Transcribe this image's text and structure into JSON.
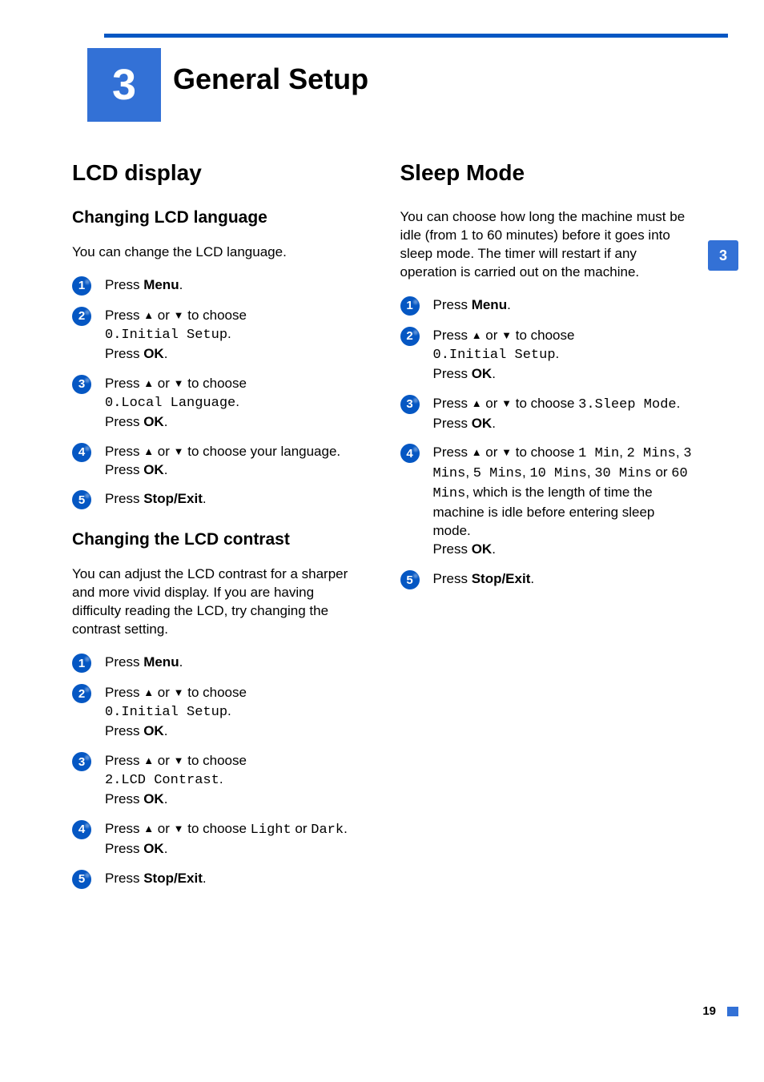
{
  "chapter": {
    "number": "3",
    "title": "General Setup"
  },
  "sideTab": "3",
  "pageNumber": "19",
  "left": {
    "sectionTitle": "LCD display",
    "sub1": {
      "title": "Changing LCD language",
      "intro": "You can change the LCD language.",
      "steps": {
        "s1": {
          "press": "Press ",
          "menu": "Menu",
          "dot": "."
        },
        "s2": {
          "t1": "Press ",
          "up": "▲",
          "or": " or ",
          "down": "▼",
          "t2": " to choose ",
          "code": "0.Initial Setup",
          "dot1": ".",
          "line2a": "Press ",
          "ok": "OK",
          "dot2": "."
        },
        "s3": {
          "t1": "Press ",
          "up": "▲",
          "or": " or ",
          "down": "▼",
          "t2": " to choose ",
          "code": "0.Local Language",
          "dot1": ".",
          "line2a": "Press ",
          "ok": "OK",
          "dot2": "."
        },
        "s4": {
          "t1": "Press ",
          "up": "▲",
          "or": " or ",
          "down": "▼",
          "t2": " to choose your language.",
          "line2a": "Press ",
          "ok": "OK",
          "dot2": "."
        },
        "s5": {
          "press": "Press ",
          "stop": "Stop/Exit",
          "dot": "."
        }
      }
    },
    "sub2": {
      "title": "Changing the LCD contrast",
      "intro": "You can adjust the LCD contrast for a sharper and more vivid display. If you are having difficulty reading the LCD, try changing the contrast setting.",
      "steps": {
        "s1": {
          "press": "Press ",
          "menu": "Menu",
          "dot": "."
        },
        "s2": {
          "t1": "Press ",
          "up": "▲",
          "or": " or ",
          "down": "▼",
          "t2": " to choose ",
          "code": "0.Initial Setup",
          "dot1": ".",
          "line2a": "Press ",
          "ok": "OK",
          "dot2": "."
        },
        "s3": {
          "t1": "Press ",
          "up": "▲",
          "or": " or ",
          "down": "▼",
          "t2": " to choose ",
          "code": "2.LCD Contrast",
          "dot1": ".",
          "line2a": "Press ",
          "ok": "OK",
          "dot2": "."
        },
        "s4": {
          "t1": "Press ",
          "up": "▲",
          "or": " or ",
          "down": "▼",
          "t2": " to choose ",
          "codeL": "Light",
          "orWord": " or ",
          "codeD": "Dark",
          "dot1": ".",
          "line2a": "Press ",
          "ok": "OK",
          "dot2": "."
        },
        "s5": {
          "press": "Press ",
          "stop": "Stop/Exit",
          "dot": "."
        }
      }
    }
  },
  "right": {
    "sectionTitle": "Sleep Mode",
    "intro": "You can choose how long the machine must be idle (from 1 to 60 minutes) before it goes into sleep mode. The timer will restart if any operation is carried out on the machine.",
    "steps": {
      "s1": {
        "press": "Press ",
        "menu": "Menu",
        "dot": "."
      },
      "s2": {
        "t1": "Press ",
        "up": "▲",
        "or": " or ",
        "down": "▼",
        "t2": " to choose ",
        "code": "0.Initial Setup",
        "dot1": ".",
        "line2a": "Press ",
        "ok": "OK",
        "dot2": "."
      },
      "s3": {
        "t1": "Press ",
        "up": "▲",
        "or": " or ",
        "down": "▼",
        "t2": " to choose ",
        "code": "3.Sleep Mode",
        "dot1": ".",
        "line2a": "Press ",
        "ok": "OK",
        "dot2": "."
      },
      "s4": {
        "t1": "Press ",
        "up": "▲",
        "or": " or ",
        "down": "▼",
        "t2": " to choose ",
        "c1": "1 Min",
        "comma1": ", ",
        "c2": "2 Mins",
        "comma2": ", ",
        "c3": "3 Mins",
        "comma3": ", ",
        "c4": "5 Mins",
        "comma4": ", ",
        "c5": "10 Mins",
        "comma5": ", ",
        "c6": "30 Mins",
        "orWord": " or ",
        "c7": "60 Mins",
        "commaLast": ", ",
        "tail": " which is the length of time the machine is idle before entering sleep mode.",
        "line2a": "Press ",
        "ok": "OK",
        "dot2": "."
      },
      "s5": {
        "press": "Press ",
        "stop": "Stop/Exit",
        "dot": "."
      }
    }
  }
}
